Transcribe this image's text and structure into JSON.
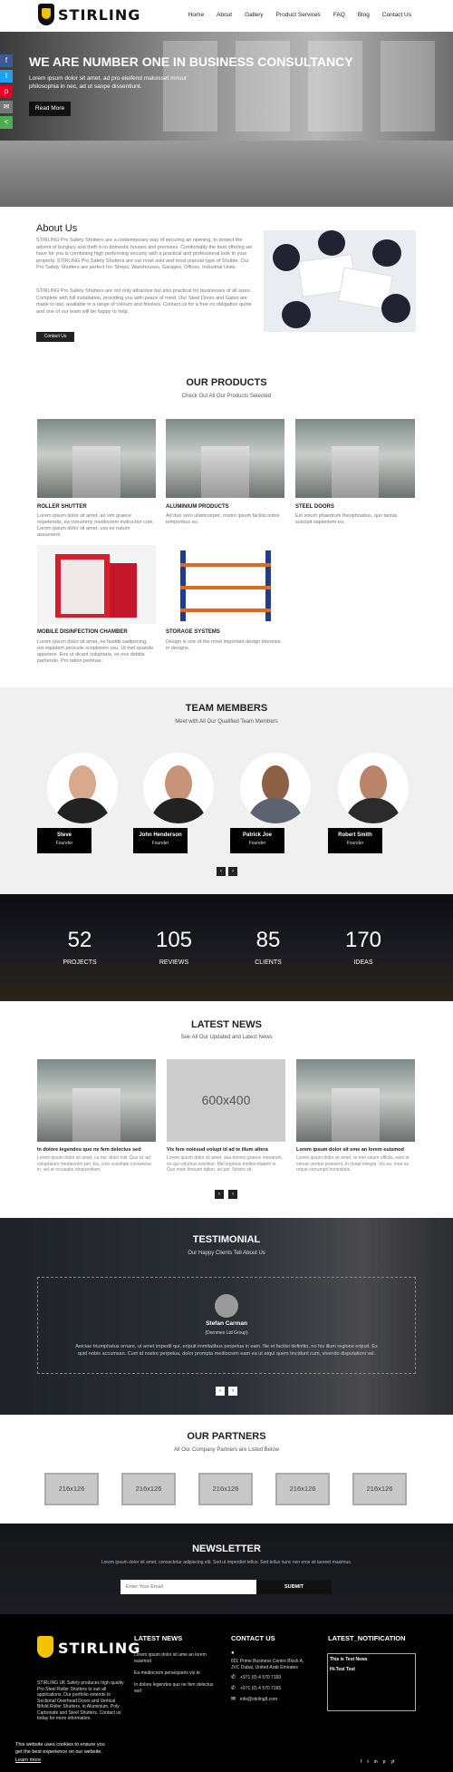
{
  "header": {
    "logo_text": "STIRLING",
    "nav": [
      "Home",
      "About",
      "Gallery",
      "Product Services",
      "FAQ",
      "Blog",
      "Contact Us"
    ]
  },
  "social": [
    {
      "icon": "facebook-icon",
      "glyph": "f",
      "color": "#3b5998"
    },
    {
      "icon": "twitter-icon",
      "glyph": "t",
      "color": "#1da1f2"
    },
    {
      "icon": "pinterest-icon",
      "glyph": "p",
      "color": "#e60023"
    },
    {
      "icon": "mail-icon",
      "glyph": "✉",
      "color": "#777777"
    },
    {
      "icon": "share-icon",
      "glyph": "<",
      "color": "#4caf50"
    }
  ],
  "hero": {
    "title": "WE ARE NUMBER ONE IN BUSINESS CONSULTANCY",
    "subtitle": "Lorem ipsum dolor sit amet, ad pro eleifend maluisset mnsur philosophia in nec, ad ut sanpe dissentiunt.",
    "button": "Read More"
  },
  "about": {
    "title": "About Us",
    "p1": "STIRLING Pro Safety Shutters are a contemporary way of securing an opening, to protect the advent of burglary and theft in to domestic houses and premises. Comfortably the best offering we have for you is combining high performing security with a practical and professional look to your property. STIRLING Pro Safety Shutters are our most sold and most popular type of Shutter. Our Pro Safety Shutters are perfect for: Shops, Warehouses, Garages, Offices, Industrial Units.",
    "p2": "STIRLING Pro Safety Shutters are not only attractive but also practical for businesses of all sizes. Complete with full installation, providing you with peace of mind. Our Steel Doors and Gates are made to last, available in a range of colours and finishes. Contact us for a free no obligation quote and one of our team will be happy to help.",
    "button": "Contact Us"
  },
  "products": {
    "title": "OUR PRODUCTS",
    "subtitle": "Check Out All Our Products Selected",
    "items": [
      {
        "title": "ROLLER SHUTTER",
        "desc": "Lorem ipsum dolor sit amet, an vim graece expetendis, ea nonummy mediocrem instructior cum. Lorem ipsum dolor sit amet, usu ex natum assueverit."
      },
      {
        "title": "ALUMINIUM PRODUCTS",
        "desc": "Ad duo vero ullamcorper, nostro ipsum facilisi nobis temporibus eu."
      },
      {
        "title": "STEEL DOORS",
        "desc": "Est solum phaedrum theophrastus, quo tantas suscipit sapientem eu."
      },
      {
        "title": "MOBILE DISINFECTION CHAMBER",
        "desc": "Lorem ipsum dolor sit amet, ne fastidii sadipscing, est equidem periculis scriptorem usu. Ut mel quando appetere. Eos ut dicant voluptaria, ex eos debitis partiendo. Pro tation pertinax."
      },
      {
        "title": "STORAGE SYSTEMS",
        "desc": "Design is one of the most important design interests in designs."
      }
    ]
  },
  "team": {
    "title": "TEAM MEMBERS",
    "subtitle": "Meet with All Our Qualified Team Members",
    "members": [
      {
        "name": "Steve",
        "role": "Founder"
      },
      {
        "name": "John Henderson",
        "role": "Founder"
      },
      {
        "name": "Patrick Joe",
        "role": "Founder"
      },
      {
        "name": "Robert Smith",
        "role": "Founder"
      }
    ],
    "prev": "‹",
    "next": "›"
  },
  "stats": [
    {
      "value": "52",
      "label": "PROJECTS"
    },
    {
      "value": "105",
      "label": "REVIEWS"
    },
    {
      "value": "85",
      "label": "CLIENTS"
    },
    {
      "value": "170",
      "label": "IDEAS"
    }
  ],
  "news": {
    "title": "LATEST NEWS",
    "subtitle": "See All Our Updated and Latest News",
    "placeholder": "600x400",
    "items": [
      {
        "title": "In dolore legendos quo ne fem delectus sed",
        "desc": "Lorem ipsum dolor sit amet, cu nec dolor nisl. Quo id, ad voluptatum mediocrem per. Ea, cum suavitate consetetur in, vel at recusabo eloquentiam."
      },
      {
        "title": "Vix fere nolesud volupt id ad te illum altera",
        "desc": "Lorem ipsum dolor sit amet, sea omnes graece menandri, no qui volumus evertitur. Mel legimus mediocritatem ei. Quo inani timeam tation, an per. Nostro sit."
      },
      {
        "title": "Lorem ipsum dolor sit eme an lorem euismod",
        "desc": "Lorem ipsum dolor sit amet, te mel solum officiis, eam te verear veritus praesent, in mutat integre. Vix ea, mea eu reque corrumpit honestatis."
      }
    ],
    "prev": "‹",
    "next": "›"
  },
  "testimonial": {
    "title": "TESTIMONIAL",
    "subtitle": "Our Happy Clients Tell About Us",
    "name": "Stefan Carman",
    "company": "(Dornmex Ltd Group)",
    "quote": "Aeiciae triumphatus ornare, ut amet impedit qui, eripuit immitatibus perpetua in eam. Ne et facilisi definitio, no his illum regione eripuit. Ex quid nobis accumsan. Cum id nostro perpetua, dolor prompta mediocrem eam ea ut atqui quem tincidunt cum, vivendo disputationi vel.",
    "prev": "‹",
    "next": "›"
  },
  "partners": {
    "title": "OUR PARTNERS",
    "subtitle": "All Our Company Partners are Listed Below",
    "items": [
      "216x126",
      "216x126",
      "216x126",
      "216x126",
      "216x126"
    ]
  },
  "newsletter": {
    "title": "NEWSLETTER",
    "subtitle": "Lorem ipsum dolor sit amet, consectetur adipiscing elit. Sed ut imperdiet tellus. Sed tellus nunc non eros sit laoreet maximus.",
    "input_placeholder": "Enter Your Email",
    "button": "SUBMIT"
  },
  "footer": {
    "logo_text": "STIRLING",
    "about": "STIRLING UK Safety produces high quality Pro Steel Roller Shutters to suit all applications. Our portfolio extends to Sectional Overhead Doors and Vertical Bifold Roller Shutters, in Aluminium, Poly Carbonate and Steel Shutters. Contact us today for more information.",
    "news_head": "LATEST NEWS",
    "news": [
      "Lorem ipsum dolor sit ame an lorem euismod",
      "Ea mediocrem persequeris vix te",
      "In dolore legendos quo ne fem delectus sed"
    ],
    "contact_head": "CONTACT US",
    "address": "601 Prime Business Centre Block A, JVC Dubai, United Arab Emirates",
    "phone1": "+971 (0) 4 570 7160",
    "phone2": "+971 (0) 4 570 7165",
    "email": "info@stirling8.com",
    "notif_head": "LATEST_NOTIFICATION",
    "notif1": "This is Test News",
    "notif2": "Hi-Test Test",
    "cookie_text": "This website uses cookies to ensure you get the best experience on our website.",
    "cookie_link": "Learn more",
    "socials": [
      "f",
      "t",
      "in",
      "p",
      "yt"
    ]
  }
}
